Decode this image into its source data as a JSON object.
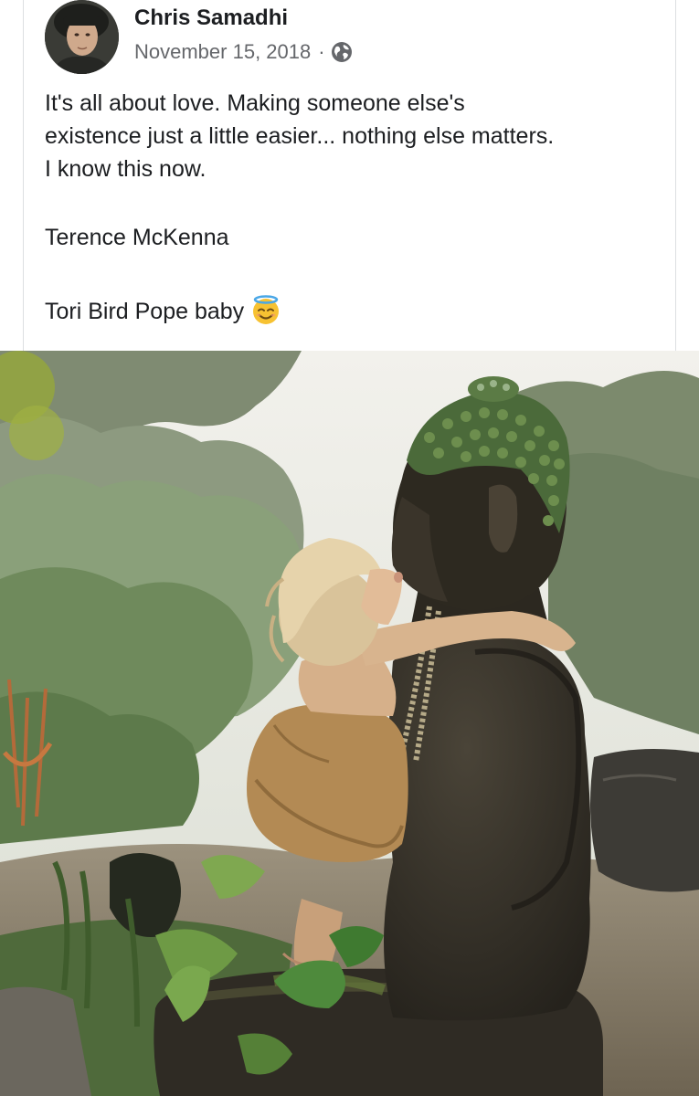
{
  "post": {
    "author": "Chris Samadhi",
    "date": "November 15, 2018",
    "separator": "·",
    "privacy_icon": "globe-icon",
    "text_lines": [
      "It's all about love. Making someone else's",
      "existence just a little easier... nothing else matters.",
      "I know this now."
    ],
    "attribution": "Terence McKenna",
    "caption": "Tori Bird Pope baby",
    "caption_emoji": "smiling-face-with-halo-emoji"
  },
  "colors": {
    "author": "#1c1e21",
    "meta": "#65676b",
    "border": "#dddfe2"
  }
}
